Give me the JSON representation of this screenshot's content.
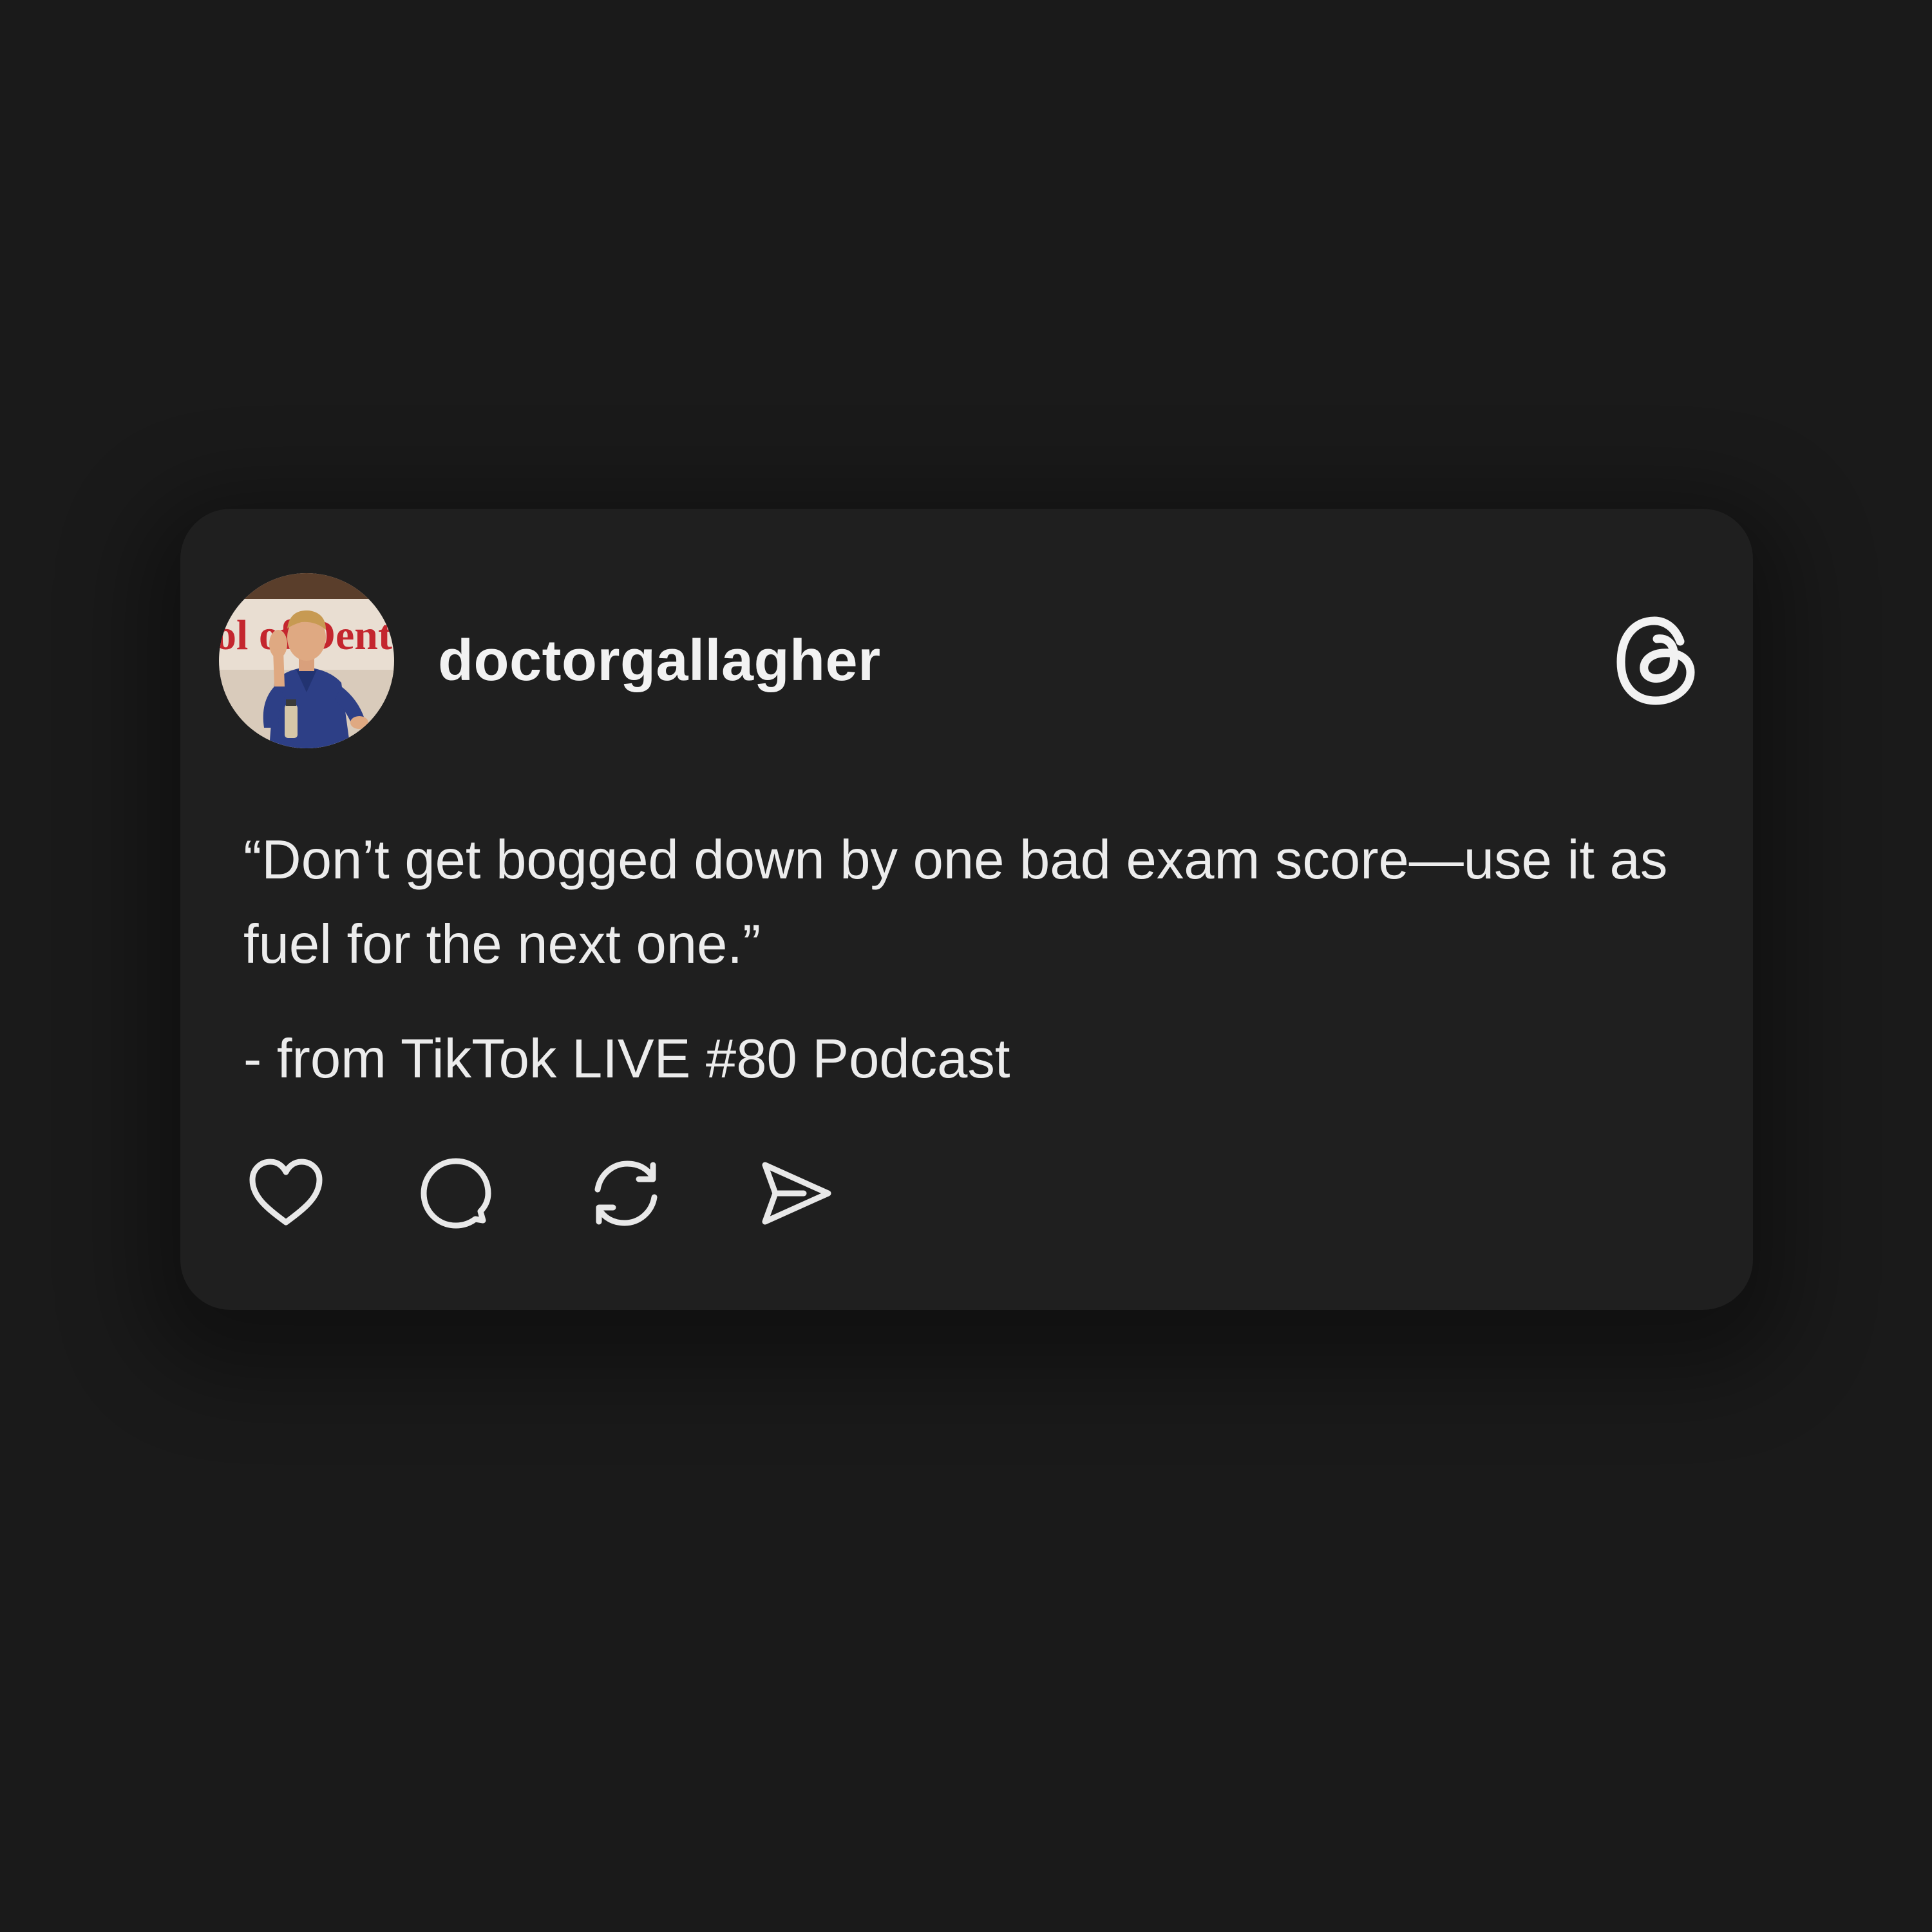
{
  "post": {
    "username": "doctorgallagher",
    "quote": "“Don’t get bogged down by one bad exam score—use it as fuel for the next one.”",
    "source": "- from TikTok LIVE #80 Podcast",
    "avatar_sign_text": "ol of Dental"
  },
  "icons": {
    "brand": "threads-logo-icon",
    "actions": [
      "heart-icon",
      "comment-icon",
      "repost-icon",
      "share-icon"
    ]
  },
  "colors": {
    "background": "#1a1a1a",
    "card": "#1f1f1f",
    "text": "#ececec",
    "icon": "#e8e8e8"
  }
}
